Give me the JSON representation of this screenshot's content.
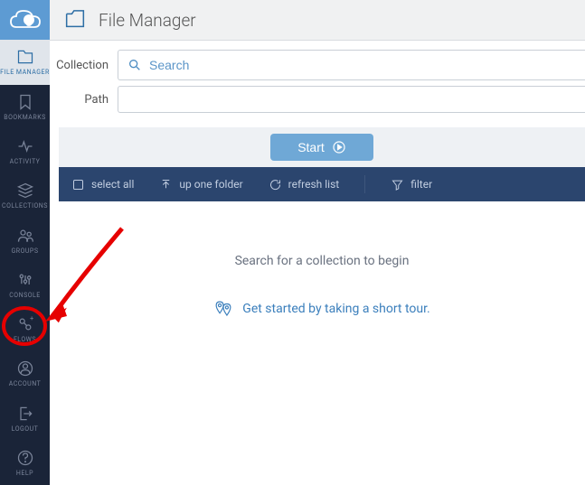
{
  "header": {
    "title": "File Manager"
  },
  "sidebar": {
    "items": [
      {
        "label": "FILE MANAGER"
      },
      {
        "label": "BOOKMARKS"
      },
      {
        "label": "ACTIVITY"
      },
      {
        "label": "COLLECTIONS"
      },
      {
        "label": "GROUPS"
      },
      {
        "label": "CONSOLE"
      },
      {
        "label": "FLOWS"
      },
      {
        "label": "ACCOUNT"
      },
      {
        "label": "LOGOUT"
      },
      {
        "label": "HELP"
      }
    ]
  },
  "form": {
    "collection_label": "Collection",
    "search_placeholder": "Search",
    "path_label": "Path",
    "start_button": "Start"
  },
  "toolbar": {
    "select_all": "select all",
    "up_one_folder": "up one folder",
    "refresh_list": "refresh list",
    "filter": "filter"
  },
  "content": {
    "empty_message": "Search for a collection to begin",
    "tour_text": "Get started by taking a short tour."
  }
}
